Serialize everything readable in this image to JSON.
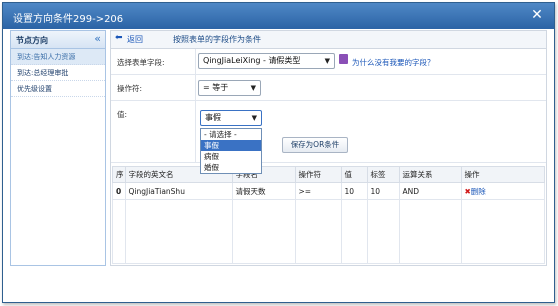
{
  "window": {
    "title": "设置方向条件299->206"
  },
  "sidebar": {
    "title": "节点方向",
    "collapse_glyph": "«",
    "items": [
      {
        "label": "到达:告知人力资源"
      },
      {
        "label": "到达:总经理审批"
      },
      {
        "label": "优先级设置"
      }
    ]
  },
  "toolbar": {
    "back_label": "返回",
    "hint": "按照表单的字段作为条件"
  },
  "form": {
    "field_label": "选择表单字段:",
    "field_value": "QingJiaLeiXing - 请假类型",
    "why_link": "为什么没有我要的字段？",
    "operator_label": "操作符:",
    "operator_value": "= 等于",
    "value_label": "值:",
    "value_selected": "事假",
    "value_options": [
      "- 请选择 -",
      "事假",
      "病假",
      "婚假"
    ],
    "save_or_label": "保存为OR条件"
  },
  "table": {
    "headers": [
      "序",
      "字段的英文名",
      "字段名",
      "操作符",
      "值",
      "标签",
      "运算关系",
      "操作"
    ],
    "rows": [
      {
        "idx": "0",
        "field_en": "QingJiaTianShu",
        "field_name": "请假天数",
        "op": ">=",
        "value": "10",
        "label": "10",
        "relation": "AND",
        "action": "删除"
      }
    ]
  },
  "colors": {
    "title_bar": "#2b63a5",
    "accent": "#1a56b8",
    "delete_icon": "#d01818"
  }
}
